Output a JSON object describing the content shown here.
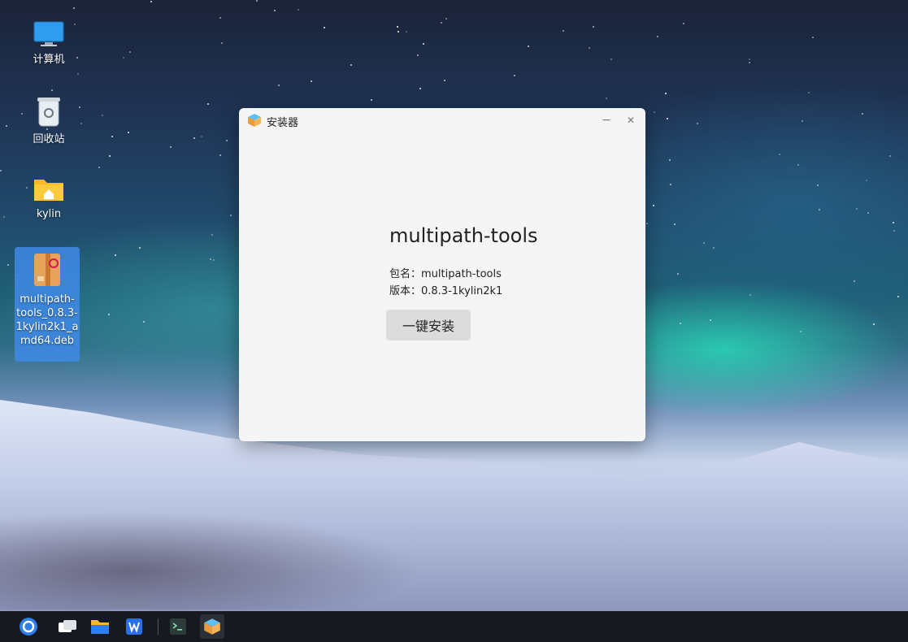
{
  "desktop": {
    "icons": [
      {
        "label": "计算机",
        "icon": "computer-icon"
      },
      {
        "label": "回收站",
        "icon": "trash-icon"
      },
      {
        "label": "kylin",
        "icon": "home-folder-icon"
      },
      {
        "label": "multipath-\ntools_0.8.3-\n1kylin2k1_a\nmd64.deb",
        "icon": "deb-package-icon",
        "selected": true
      }
    ]
  },
  "window": {
    "title": "安装器",
    "package_name": "multipath-tools",
    "package_label": "包名：multipath-tools",
    "version_label": "版本：0.8.3-1kylin2k1",
    "install_button": "一键安装",
    "minimize_glyph": "−",
    "close_glyph": "✕"
  },
  "taskbar": {
    "items": [
      "start-menu-icon",
      "multitask-view-icon",
      "file-manager-icon",
      "wps-writer-icon",
      "terminal-icon",
      "installer-icon"
    ]
  },
  "colors": {
    "accent": "#3f89e6",
    "taskbar": "#16191f",
    "window_bg": "#f5f5f5",
    "button_bg": "#dcdcdc"
  }
}
